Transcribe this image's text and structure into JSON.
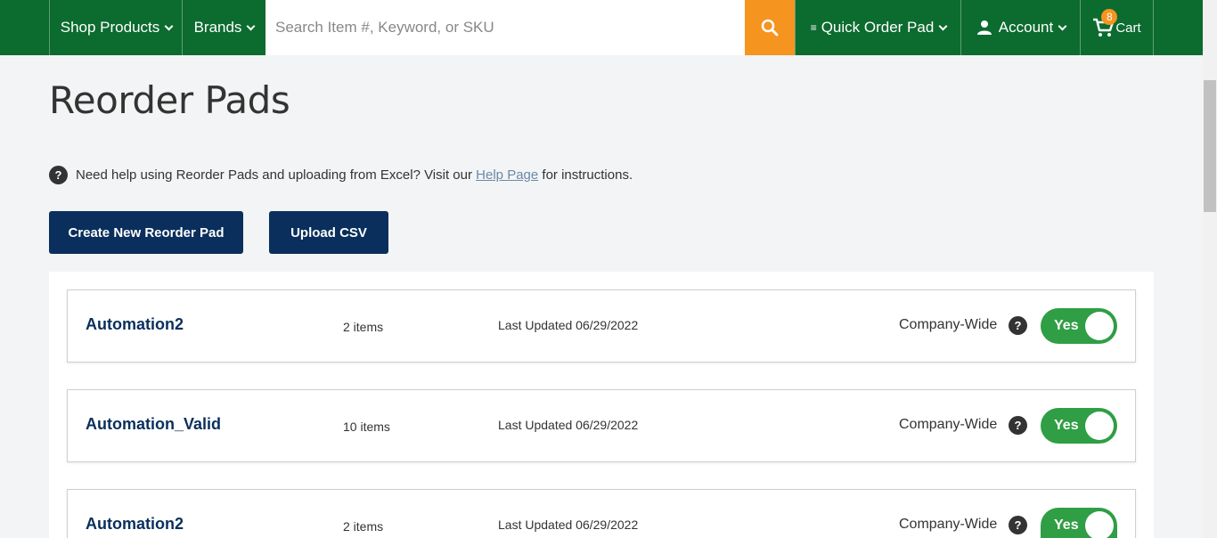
{
  "nav": {
    "shop_products": "Shop Products",
    "brands": "Brands",
    "search_placeholder": "Search Item #, Keyword, or SKU",
    "quick_order_pad": "Quick Order Pad",
    "account": "Account",
    "cart_label": "Cart",
    "cart_count": "8",
    "search_icon": "search-icon",
    "user_icon": "user-icon",
    "cart_icon": "cart-icon"
  },
  "page": {
    "title": "Reorder Pads",
    "help_prefix": "Need help using Reorder Pads and uploading from Excel? Visit our",
    "help_link": "Help Page",
    "help_suffix": "for instructions.",
    "create_button": "Create New Reorder Pad",
    "upload_button": "Upload CSV"
  },
  "colors": {
    "nav_green": "#0c6b2f",
    "search_orange": "#f5941e",
    "button_navy": "#0a2f5c",
    "toggle_green": "#2f9e44"
  },
  "pads": [
    {
      "name": "Automation2",
      "count": "2 items",
      "updated": "Last Updated 06/29/2022",
      "scope": "Company-Wide",
      "toggle": "Yes"
    },
    {
      "name": "Automation_Valid",
      "count": "10 items",
      "updated": "Last Updated 06/29/2022",
      "scope": "Company-Wide",
      "toggle": "Yes"
    },
    {
      "name": "Automation2",
      "count": "2 items",
      "updated": "Last Updated 06/29/2022",
      "scope": "Company-Wide",
      "toggle": "Yes"
    }
  ]
}
